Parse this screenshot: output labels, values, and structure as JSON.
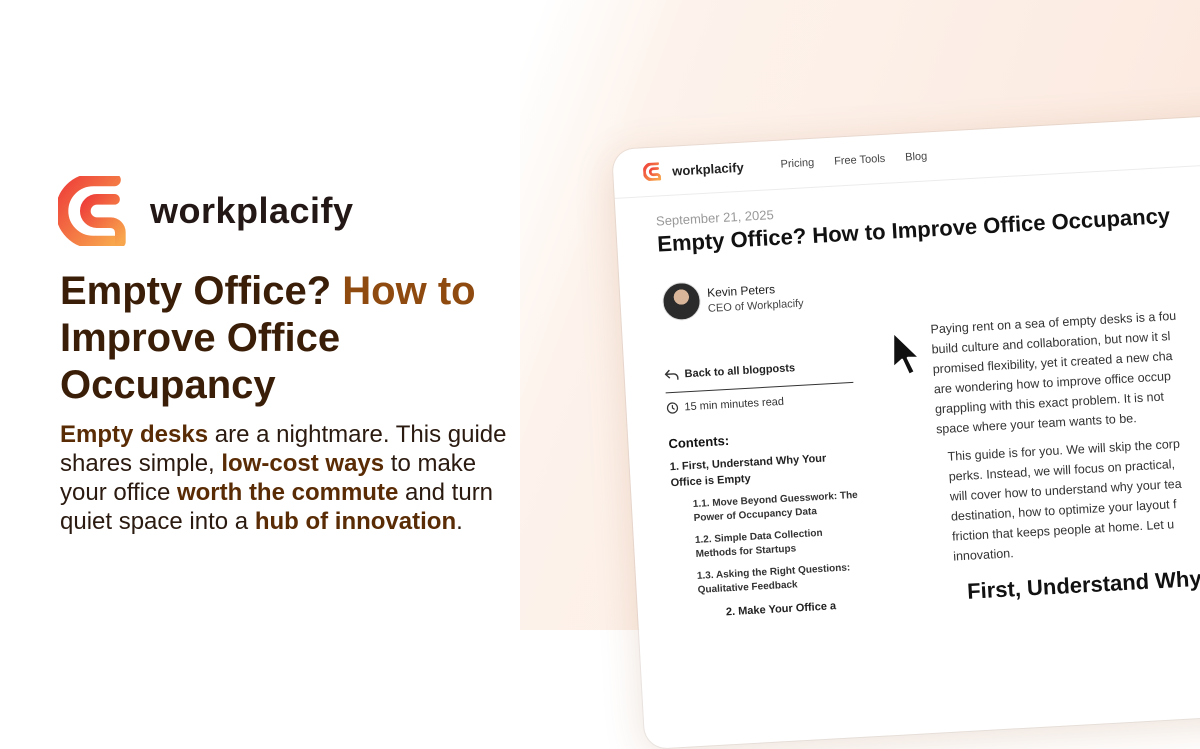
{
  "brand": {
    "name": "workplacify",
    "logo_colors": {
      "start": "#ee3f3a",
      "end": "#f8a64d"
    }
  },
  "hero": {
    "headline_part1": "Empty Office? ",
    "headline_part2": "How to",
    "headline_part3": "Improve Office",
    "headline_part4": "Occupancy",
    "sub": [
      {
        "text": "Empty desks",
        "bold": true
      },
      {
        "text": " are a nightmare. This guide shares simple, ",
        "bold": false
      },
      {
        "text": "low-cost ways",
        "bold": true
      },
      {
        "text": " to make your office ",
        "bold": false
      },
      {
        "text": "worth the commute",
        "bold": true
      },
      {
        "text": " and turn quiet space into a ",
        "bold": false
      },
      {
        "text": "hub of innovation",
        "bold": true
      },
      {
        "text": ".",
        "bold": false
      }
    ]
  },
  "mock": {
    "nav": {
      "brand": "workplacify",
      "links": [
        "Pricing",
        "Free Tools",
        "Blog"
      ]
    },
    "post": {
      "date": "September 21, 2025",
      "title": "Empty Office? How to Improve Office Occupancy",
      "author_name": "Kevin Peters",
      "author_role": "CEO of Workplacify"
    },
    "sidebar": {
      "back_label": "Back to all blogposts",
      "read_time": "15 min minutes read",
      "contents_title": "Contents:",
      "toc": [
        {
          "label": "1. First, Understand Why Your Office is Empty",
          "level": 1
        },
        {
          "label": "1.1. Move Beyond Guesswork: The Power of Occupancy Data",
          "level": 2
        },
        {
          "label": "1.2. Simple Data Collection Methods for Startups",
          "level": 2
        },
        {
          "label": "1.3. Asking the Right Questions: Qualitative Feedback",
          "level": 2
        },
        {
          "label": "2. Make Your Office a",
          "level": 1
        }
      ]
    },
    "article": {
      "p1_lines": [
        "Paying rent on a sea of empty desks is a fou",
        "build culture and collaboration, but now it sl",
        "promised flexibility, yet it created a new cha",
        "are wondering how to improve office occup",
        "grappling with this exact problem. It is not",
        "space where your team wants to be."
      ],
      "p2_lines": [
        "This guide is for you. We will skip the corp",
        "perks. Instead, we will focus on practical,",
        "will cover how to understand why your tea",
        "destination, how to optimize your layout f",
        "friction that keeps people at home. Let u",
        "innovation."
      ],
      "heading": "First, Understand Why Y"
    }
  }
}
